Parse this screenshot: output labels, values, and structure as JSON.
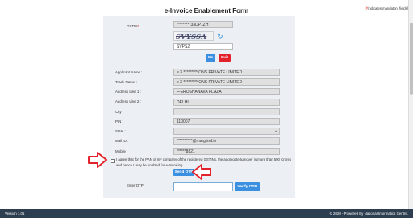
{
  "header": {
    "title": "e-Invoice Enablement Form",
    "mandatory_note_star": "[*",
    "mandatory_note_text": "indicates mandatory fields]"
  },
  "form": {
    "gstin_label": "GSTIN",
    "gstin_required_mark": "*",
    "gstin_value": "*********33DP1ZH",
    "captcha_text": "SVYSSA",
    "captcha_input_value": "SVPS2",
    "go_label": "Go",
    "exit_label": "Exit",
    "fields": [
      {
        "label": "Applicant Name :",
        "value": "e 3 *********IONS PRIVATE LIMITED"
      },
      {
        "label": "Trade Name :",
        "value": "e 3 *********IONS PRIVATE LIMITED"
      },
      {
        "label": "Address Line 1 :",
        "value": "F-EROSHANAVA PLAZA"
      },
      {
        "label": "Address Line 2 :",
        "value": "DELHI"
      },
      {
        "label": "City :",
        "value": ""
      },
      {
        "label": "PIN :",
        "value": "110007"
      },
      {
        "label": "State :",
        "value": ""
      },
      {
        "label": "Mail ID :",
        "value": "**********@marg.ind.in"
      },
      {
        "label": "Mobile :",
        "value": "******8821"
      }
    ],
    "agree_text": "I agree that for the PAN of my company of the registered GSTINs, the aggregate turnover is more than 500 Crores and hence I may be enabled for e-Invoicing.",
    "send_otp_label": "Send OTP",
    "enter_otp_label": "Enter OTP:",
    "otp_value": "",
    "verify_otp_label": "Verify OTP"
  },
  "footer": {
    "version": "Version 1.01",
    "copyright": "© 2020 - Powered By National Informatics Centre."
  },
  "colors": {
    "primary_button": "#3b8fe0",
    "exit_button": "#e2232b",
    "arrow": "#e2232b",
    "footer_bg": "#2c3e50"
  },
  "icons": [
    "refresh-icon",
    "dropdown-caret-icon",
    "red-arrow-pointer-icon"
  ]
}
